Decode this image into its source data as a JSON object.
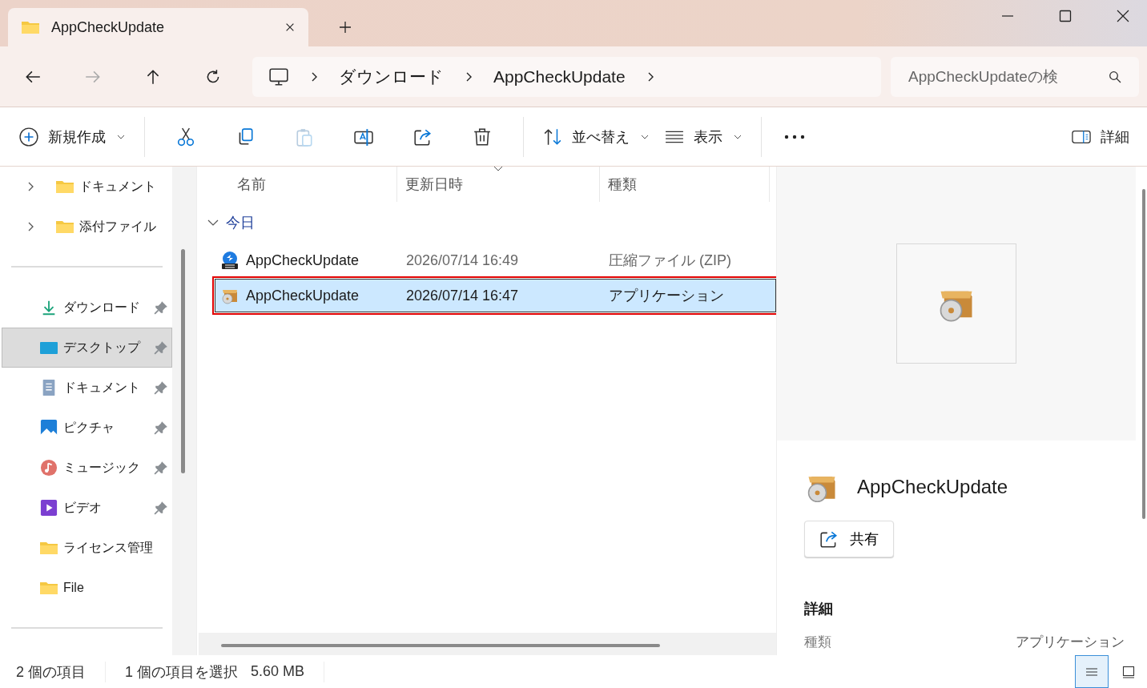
{
  "tab": {
    "title": "AppCheckUpdate"
  },
  "address": {
    "crumbs": [
      "ダウンロード",
      "AppCheckUpdate"
    ],
    "search_placeholder": "AppCheckUpdateの検"
  },
  "toolbar": {
    "new_label": "新規作成",
    "actions": [
      {
        "kind": "cut",
        "disabled": false
      },
      {
        "kind": "copy",
        "disabled": false
      },
      {
        "kind": "paste",
        "disabled": true
      },
      {
        "kind": "rename",
        "disabled": false
      },
      {
        "kind": "share",
        "disabled": false
      },
      {
        "kind": "delete",
        "disabled": false
      }
    ],
    "sort_label": "並べ替え",
    "view_label": "表示",
    "details_label": "詳細"
  },
  "sidebar": {
    "sections": [
      {
        "items": [
          {
            "label": "ドキュメント",
            "kind": "folder",
            "expandable": true,
            "pinned": false,
            "selected": false
          },
          {
            "label": "添付ファイル",
            "kind": "folder",
            "expandable": true,
            "pinned": false,
            "selected": false
          }
        ]
      },
      {
        "items": [
          {
            "label": "ダウンロード",
            "kind": "download",
            "expandable": false,
            "pinned": true,
            "selected": false
          },
          {
            "label": "デスクトップ",
            "kind": "desktop",
            "expandable": false,
            "pinned": true,
            "selected": true
          },
          {
            "label": "ドキュメント",
            "kind": "document",
            "expandable": false,
            "pinned": true,
            "selected": false
          },
          {
            "label": "ピクチャ",
            "kind": "picture",
            "expandable": false,
            "pinned": true,
            "selected": false
          },
          {
            "label": "ミュージック",
            "kind": "music",
            "expandable": false,
            "pinned": true,
            "selected": false
          },
          {
            "label": "ビデオ",
            "kind": "video",
            "expandable": false,
            "pinned": true,
            "selected": false
          },
          {
            "label": "ライセンス管理",
            "kind": "folder",
            "expandable": false,
            "pinned": false,
            "selected": false
          },
          {
            "label": "File",
            "kind": "folder",
            "expandable": false,
            "pinned": false,
            "selected": false
          }
        ]
      }
    ]
  },
  "list": {
    "columns": [
      {
        "label": "名前",
        "sorted": false
      },
      {
        "label": "更新日時",
        "sorted": true
      },
      {
        "label": "種類",
        "sorted": false
      }
    ],
    "groups": [
      {
        "label": "今日",
        "expanded": true,
        "rows": [
          {
            "name": "AppCheckUpdate",
            "date": "2026/07/14 16:49",
            "type": "圧縮ファイル (ZIP)",
            "kind": "zip",
            "selected": false,
            "highlighted": false
          },
          {
            "name": "AppCheckUpdate",
            "date": "2026/07/14 16:47",
            "type": "アプリケーション",
            "kind": "app",
            "selected": true,
            "highlighted": true
          }
        ]
      }
    ]
  },
  "details": {
    "title": "AppCheckUpdate",
    "share_label": "共有",
    "heading": "詳細",
    "properties": [
      {
        "label": "種類",
        "value": "アプリケーション"
      }
    ]
  },
  "status_bar": {
    "count": "2 個の項目",
    "selection": "1 個の項目を選択",
    "size": "5.60 MB",
    "views": [
      {
        "kind": "details",
        "selected": true
      },
      {
        "kind": "tiles",
        "selected": false
      }
    ]
  }
}
